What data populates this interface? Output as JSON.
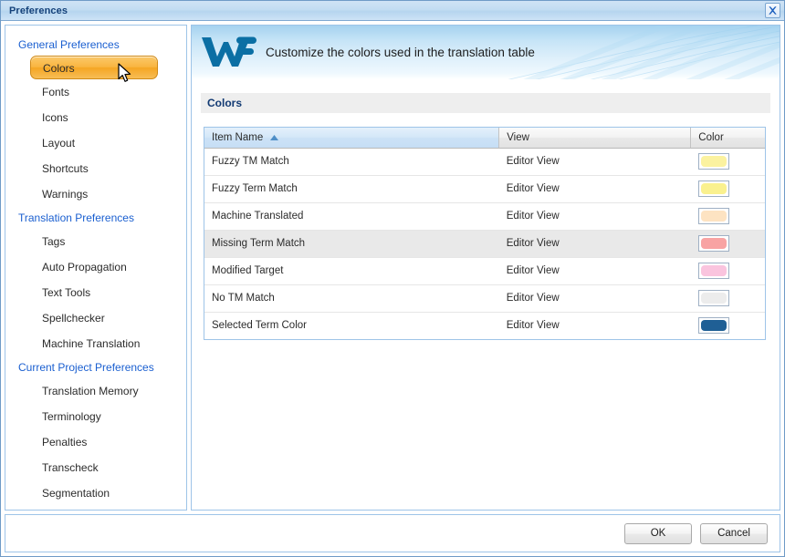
{
  "window": {
    "title": "Preferences",
    "close_icon": "close-icon"
  },
  "sidebar": {
    "groups": [
      {
        "title": "General Preferences",
        "items": [
          {
            "label": "Colors",
            "selected": true
          },
          {
            "label": "Fonts",
            "selected": false
          },
          {
            "label": "Icons",
            "selected": false
          },
          {
            "label": "Layout",
            "selected": false
          },
          {
            "label": "Shortcuts",
            "selected": false
          },
          {
            "label": "Warnings",
            "selected": false
          }
        ]
      },
      {
        "title": "Translation Preferences",
        "items": [
          {
            "label": "Tags",
            "selected": false
          },
          {
            "label": "Auto Propagation",
            "selected": false
          },
          {
            "label": "Text Tools",
            "selected": false
          },
          {
            "label": "Spellchecker",
            "selected": false
          },
          {
            "label": "Machine Translation",
            "selected": false
          }
        ]
      },
      {
        "title": "Current Project Preferences",
        "items": [
          {
            "label": "Translation Memory",
            "selected": false
          },
          {
            "label": "Terminology",
            "selected": false
          },
          {
            "label": "Penalties",
            "selected": false
          },
          {
            "label": "Transcheck",
            "selected": false
          },
          {
            "label": "Segmentation",
            "selected": false
          }
        ]
      }
    ]
  },
  "banner": {
    "logo_icon": "wordfast-wf-logo",
    "description": "Customize the colors used in the translation table",
    "logo_color": "#0b6fa4"
  },
  "section": {
    "title": "Colors"
  },
  "table": {
    "columns": [
      {
        "label": "Item Name",
        "sorted": true,
        "sort_direction": "ascending"
      },
      {
        "label": "View",
        "sorted": false,
        "sort_direction": ""
      },
      {
        "label": "Color",
        "sorted": false,
        "sort_direction": ""
      }
    ],
    "rows": [
      {
        "item_name": "Fuzzy TM Match",
        "view": "Editor View",
        "color": "#fbf2a0",
        "hover": false
      },
      {
        "item_name": "Fuzzy Term Match",
        "view": "Editor View",
        "color": "#faf18f",
        "hover": false
      },
      {
        "item_name": "Machine Translated",
        "view": "Editor View",
        "color": "#fde3c2",
        "hover": false
      },
      {
        "item_name": "Missing Term Match",
        "view": "Editor View",
        "color": "#f8a3a3",
        "hover": true
      },
      {
        "item_name": "Modified Target",
        "view": "Editor View",
        "color": "#fac4de",
        "hover": false
      },
      {
        "item_name": "No TM Match",
        "view": "Editor View",
        "color": "#ececec",
        "hover": false
      },
      {
        "item_name": "Selected Term Color",
        "view": "Editor View",
        "color": "#1f5f95",
        "hover": false
      }
    ]
  },
  "footer": {
    "ok_label": "OK",
    "cancel_label": "Cancel"
  }
}
